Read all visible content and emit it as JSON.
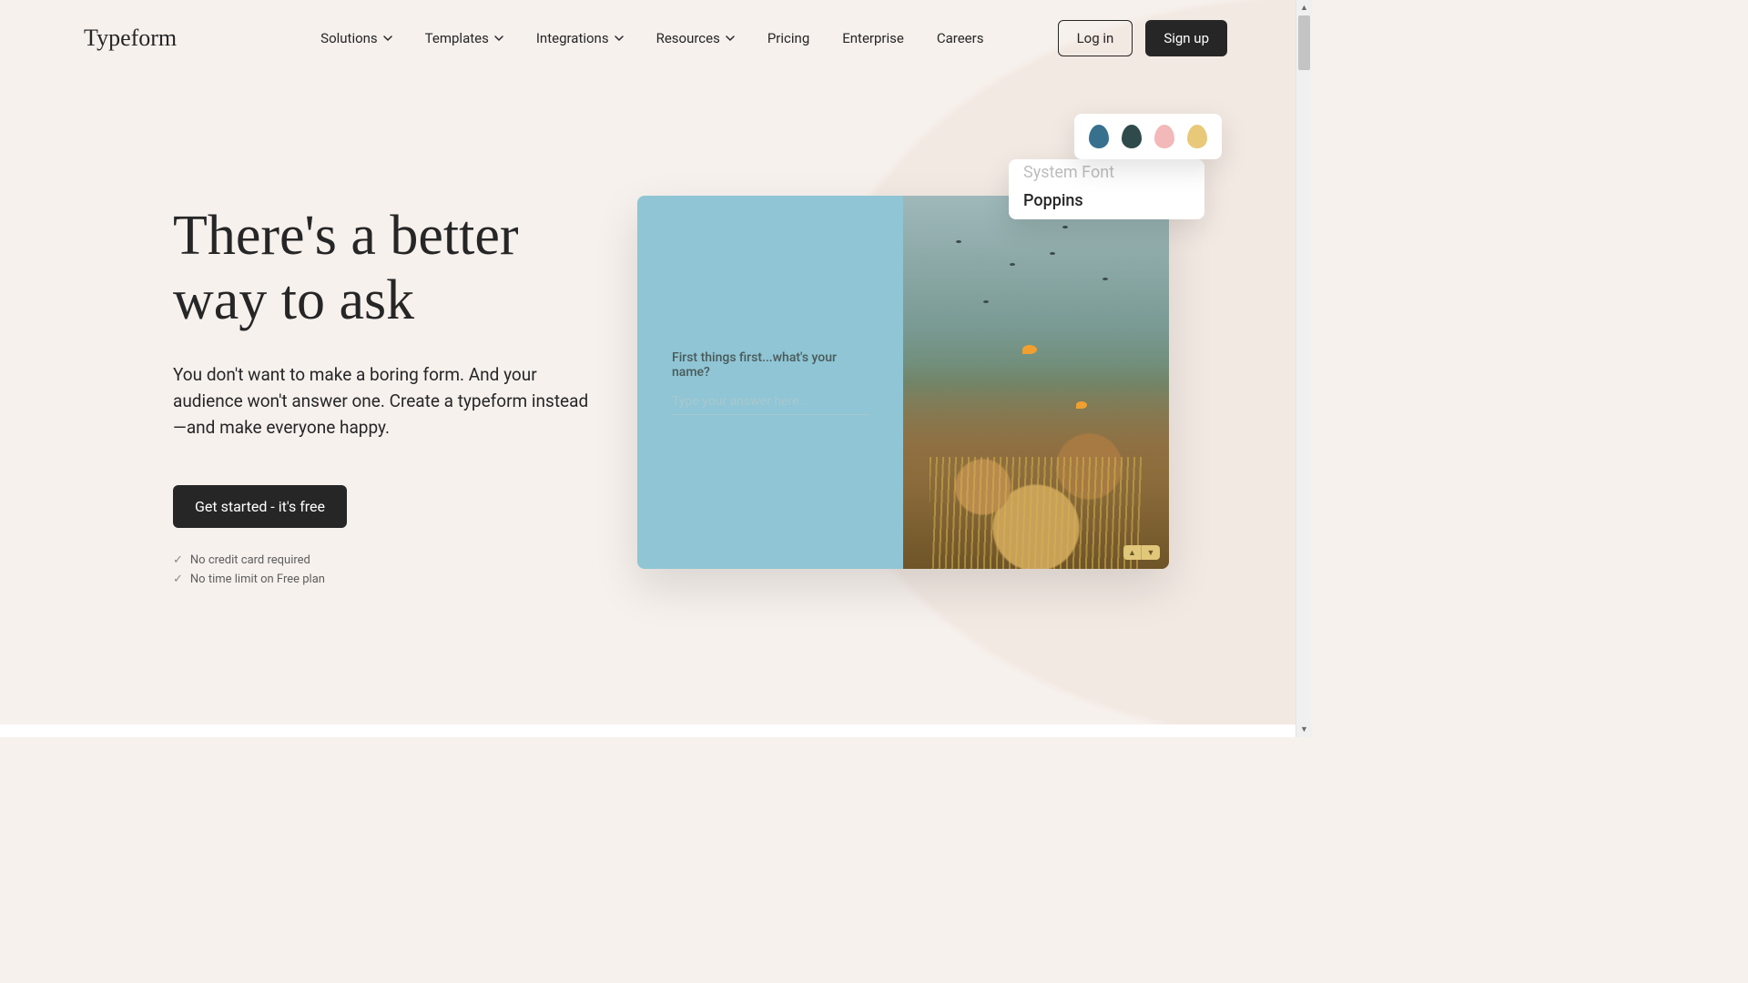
{
  "brand": "Typeform",
  "nav": {
    "items": [
      {
        "label": "Solutions",
        "dropdown": true
      },
      {
        "label": "Templates",
        "dropdown": true
      },
      {
        "label": "Integrations",
        "dropdown": true
      },
      {
        "label": "Resources",
        "dropdown": true
      },
      {
        "label": "Pricing",
        "dropdown": false
      },
      {
        "label": "Enterprise",
        "dropdown": false
      },
      {
        "label": "Careers",
        "dropdown": false
      }
    ],
    "login_label": "Log in",
    "signup_label": "Sign up"
  },
  "hero": {
    "title": "There's a better way to ask",
    "subtitle": "You don't want to make a boring form. And your audience won't answer one. Create a typeform instead—and make everyone happy.",
    "cta_label": "Get started - it's free",
    "benefits": [
      "No credit card required",
      "No time limit on Free plan"
    ]
  },
  "preview": {
    "question": "First things first...what's your name?",
    "placeholder": "Type your answer here..."
  },
  "swatches": {
    "colors": [
      "#37718e",
      "#2f4a4a",
      "#f3b8b8",
      "#e8c97a"
    ]
  },
  "font_picker": {
    "options": [
      "System Font",
      "Poppins"
    ],
    "selected_index": 1
  }
}
